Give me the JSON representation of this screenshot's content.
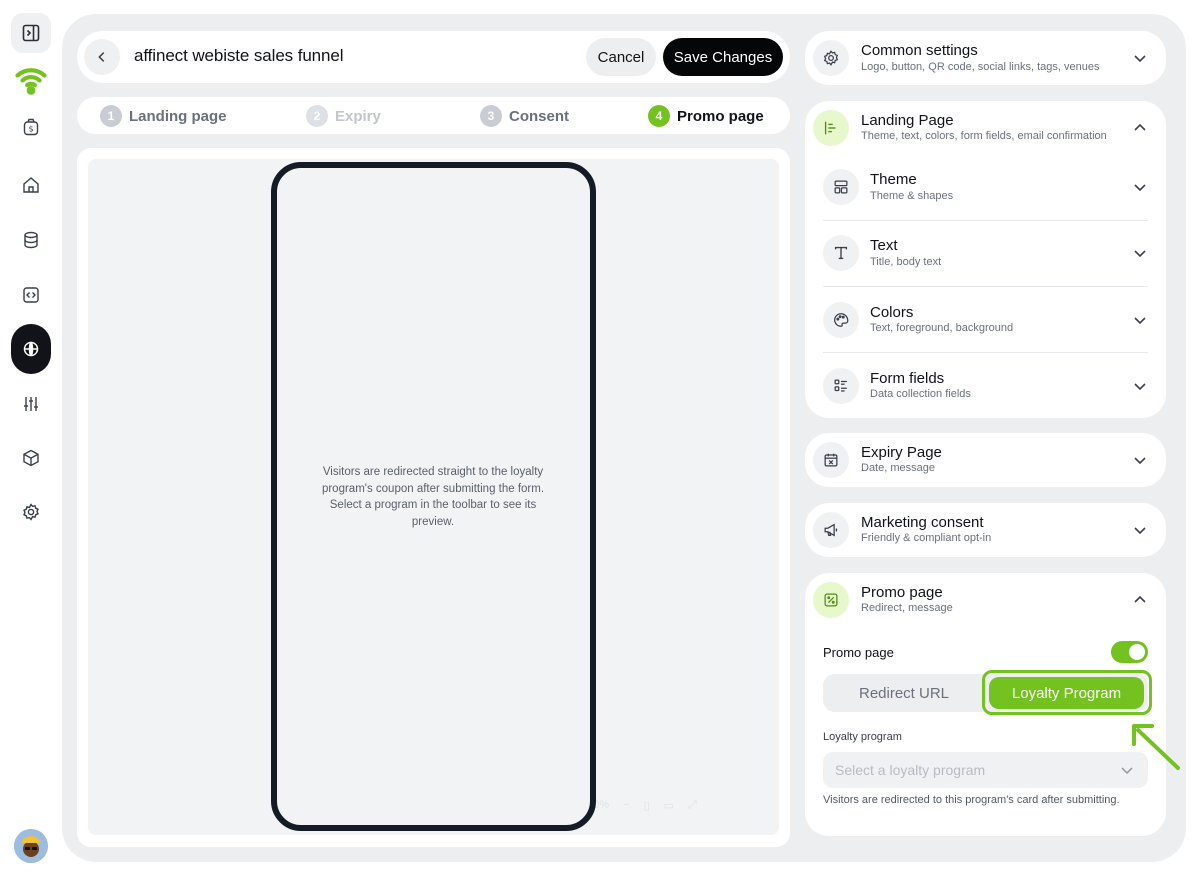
{
  "header": {
    "title": "affinect webiste sales funnel",
    "cancel_label": "Cancel",
    "save_label": "Save Changes"
  },
  "steps": [
    {
      "num": "1",
      "label": "Landing page",
      "state": "done"
    },
    {
      "num": "2",
      "label": "Expiry",
      "state": "disabled"
    },
    {
      "num": "3",
      "label": "Consent",
      "state": "done"
    },
    {
      "num": "4",
      "label": "Promo page",
      "state": "current"
    }
  ],
  "preview": {
    "message": "Visitors are redirected straight to the loyalty program's coupon after submitting the form. Select a program in the toolbar to see its preview.",
    "zoom": "100%"
  },
  "panels": {
    "common": {
      "title": "Common settings",
      "subtitle": "Logo, button, QR code, social links, tags, venues",
      "icon": "gear-icon"
    },
    "landing": {
      "title": "Landing Page",
      "subtitle": "Theme, text, colors, form fields, email confirmation",
      "icon": "align-left-icon"
    },
    "landing_sections": [
      {
        "title": "Theme",
        "subtitle": "Theme & shapes",
        "icon": "layout-icon"
      },
      {
        "title": "Text",
        "subtitle": "Title, body text",
        "icon": "type-icon"
      },
      {
        "title": "Colors",
        "subtitle": "Text, foreground, background",
        "icon": "palette-icon"
      },
      {
        "title": "Form fields",
        "subtitle": "Data collection fields",
        "icon": "form-list-icon"
      }
    ],
    "expiry": {
      "title": "Expiry Page",
      "subtitle": "Date, message",
      "icon": "calendar-x-icon"
    },
    "consent": {
      "title": "Marketing consent",
      "subtitle": "Friendly & compliant opt-in",
      "icon": "megaphone-icon"
    },
    "promo": {
      "title": "Promo page",
      "subtitle": "Redirect, message",
      "icon": "percent-icon"
    }
  },
  "promo_settings": {
    "toggle_label": "Promo page",
    "toggle_on": true,
    "options": [
      "Redirect URL",
      "Loyalty Program"
    ],
    "selected": "Loyalty Program",
    "field_label": "Loyalty program",
    "select_placeholder": "Select a loyalty program",
    "helper": "Visitors are redirected to this program's card after submitting."
  },
  "colors": {
    "accent": "#74c21f",
    "dark": "#050608",
    "frame": "#eceef0"
  }
}
